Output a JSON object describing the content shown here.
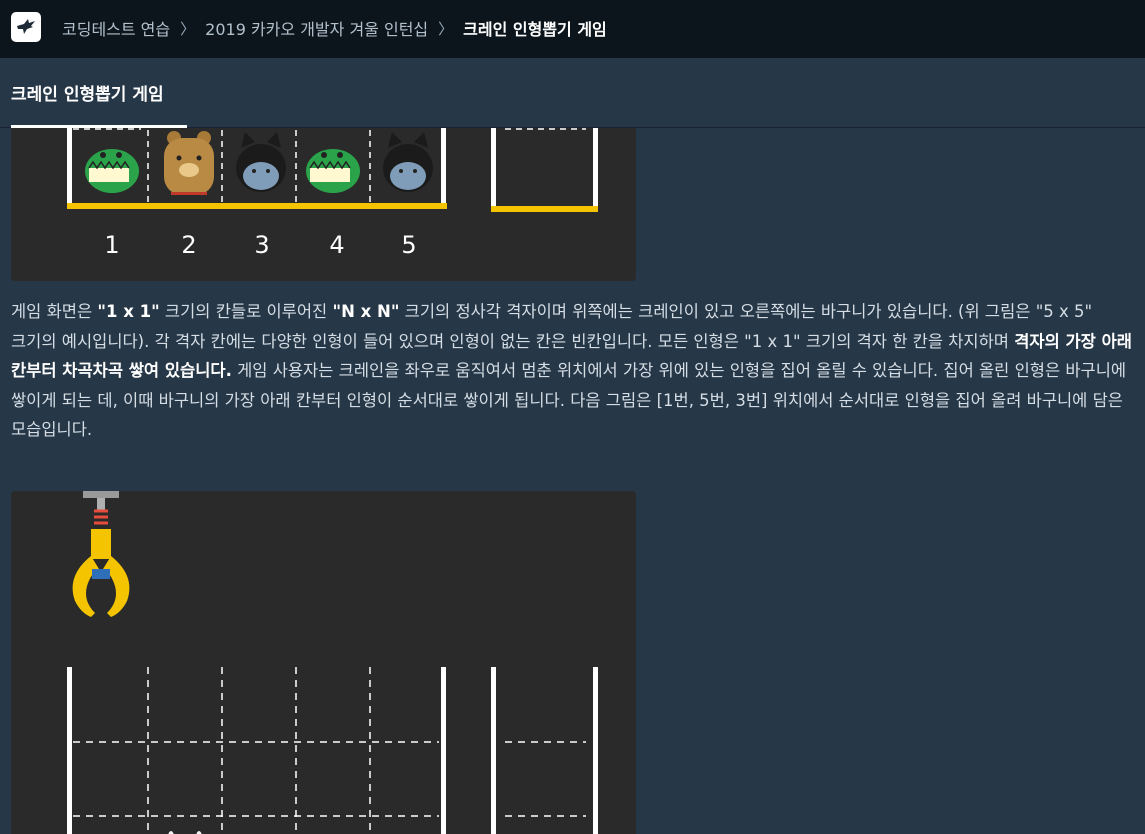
{
  "nav": {
    "breadcrumb": [
      "코딩테스트 연습",
      "2019 카카오 개발자 겨울 인턴십",
      "크레인 인형뽑기 게임"
    ],
    "separator": "〉"
  },
  "tab": {
    "label": "크레인 인형뽑기 게임"
  },
  "figure1": {
    "column_numbers": [
      "1",
      "2",
      "3",
      "4",
      "5"
    ]
  },
  "description": {
    "parts": [
      "게임 화면은 ",
      "\"1 x 1\"",
      " 크기의 칸들로 이루어진 ",
      "\"N x N\"",
      " 크기의 정사각 격자이며 위쪽에는 크레인이 있고 오른쪽에는 바구니가 있습니다. (위 그림은 \"5 x 5\" 크기의 예시입니다). 각 격자 칸에는 다양한 인형이 들어 있으며 인형이 없는 칸은 빈칸입니다. 모든 인형은 \"1 x 1\" 크기의 격자 한 칸을 차지하며 ",
      "격자의 가장 아래 칸부터 차곡차곡 쌓여 있습니다.",
      " 게임 사용자는 크레인을 좌우로 움직여서 멈춘 위치에서 가장 위에 있는 인형을 집어 올릴 수 있습니다. 집어 올린 인형은 바구니에 쌓이게 되는 데, 이때 바구니의 가장 아래 칸부터 인형이 순서대로 쌓이게 됩니다. 다음 그림은 [1번, 5번, 3번] 위치에서 순서대로 인형을 집어 올려 바구니에 담은 모습입니다."
    ]
  },
  "colors": {
    "topbar": "#0c151c",
    "page_bg": "#263747",
    "figure_bg": "#2a2a2a",
    "accent_yellow": "#f5c400"
  },
  "icons": {
    "logo": "programmers-bird-logo",
    "crane": "crane-claw-icon"
  }
}
